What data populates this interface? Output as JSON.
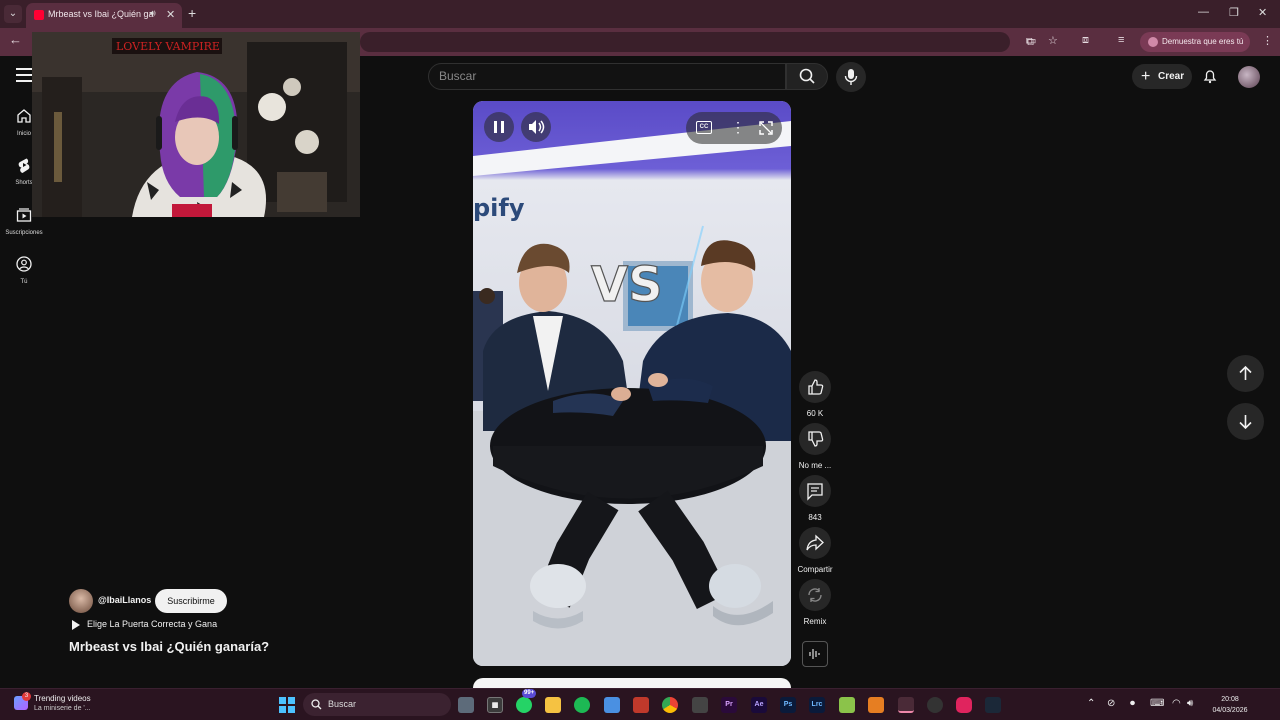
{
  "browser": {
    "tab_title": "Mrbeast vs Ibai ¿Quién ganaría?",
    "signin_label": "Demuestra que eres tú"
  },
  "masthead": {
    "search_placeholder": "Buscar",
    "create_label": "Crear"
  },
  "sidebar": {
    "items": [
      {
        "label": "Inicio",
        "icon": "home-icon"
      },
      {
        "label": "Shorts",
        "icon": "shorts-icon"
      },
      {
        "label": "Suscripciones",
        "icon": "subscriptions-icon"
      },
      {
        "label": "Tú",
        "icon": "you-icon"
      }
    ]
  },
  "video": {
    "overlay_brand_text": "pify",
    "overlay_vs_text": "VS",
    "cc_label": "CC"
  },
  "actions": {
    "likes": "60 K",
    "dislike_label": "No me ...",
    "comments": "843",
    "share_label": "Compartir",
    "remix_label": "Remix"
  },
  "channel": {
    "handle": "@IbaiLlanos",
    "subscribe_label": "Suscribirme",
    "music": "Elige La Puerta Correcta y Gana",
    "title": "Mrbeast vs Ibai ¿Quién ganaría?"
  },
  "taskbar": {
    "trending_title": "Trending videos",
    "trending_sub": "La miniserie de '...",
    "trending_badge": "3",
    "search_label": "Buscar",
    "whatsapp_badge": "99+",
    "time": "20:08",
    "date": "04/03/2026",
    "app_labels": [
      "Pr",
      "Ae",
      "Ps",
      "Lrc"
    ]
  },
  "colors": {
    "youtube_bg": "#0f0f0f",
    "browser_frame": "#5a2e40",
    "youtube_red": "#ff0033",
    "windows_accent": "#4cc2ff"
  }
}
